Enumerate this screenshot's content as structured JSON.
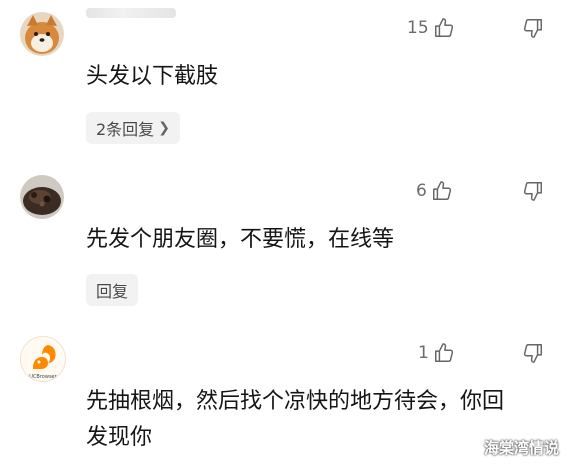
{
  "comments": [
    {
      "avatar": "shiba-dog-avatar",
      "likes": "15",
      "text": "头发以下截肢",
      "reply_label": "2条回复",
      "has_chevron": true
    },
    {
      "avatar": "food-photo-avatar",
      "likes": "6",
      "text": "先发个朋友圈，不要慌，在线等",
      "reply_label": "回复",
      "has_chevron": false
    },
    {
      "avatar": "uc-browser-squirrel-avatar",
      "likes": "1",
      "text_line1": "先抽根烟，然后找个凉快的地方待会，你回",
      "text_line2": "发现你",
      "logo_text": "UCBrowser"
    }
  ],
  "icons": {
    "like": "thumbs-up-icon",
    "dislike": "thumbs-down-icon",
    "chevron": "chevron-right-icon"
  },
  "watermark": "海棠湾情说",
  "colors": {
    "text": "#151515",
    "meta": "#6b6b6b",
    "reply_bg": "#f2f2f2",
    "uc_orange": "#ff8a00"
  }
}
